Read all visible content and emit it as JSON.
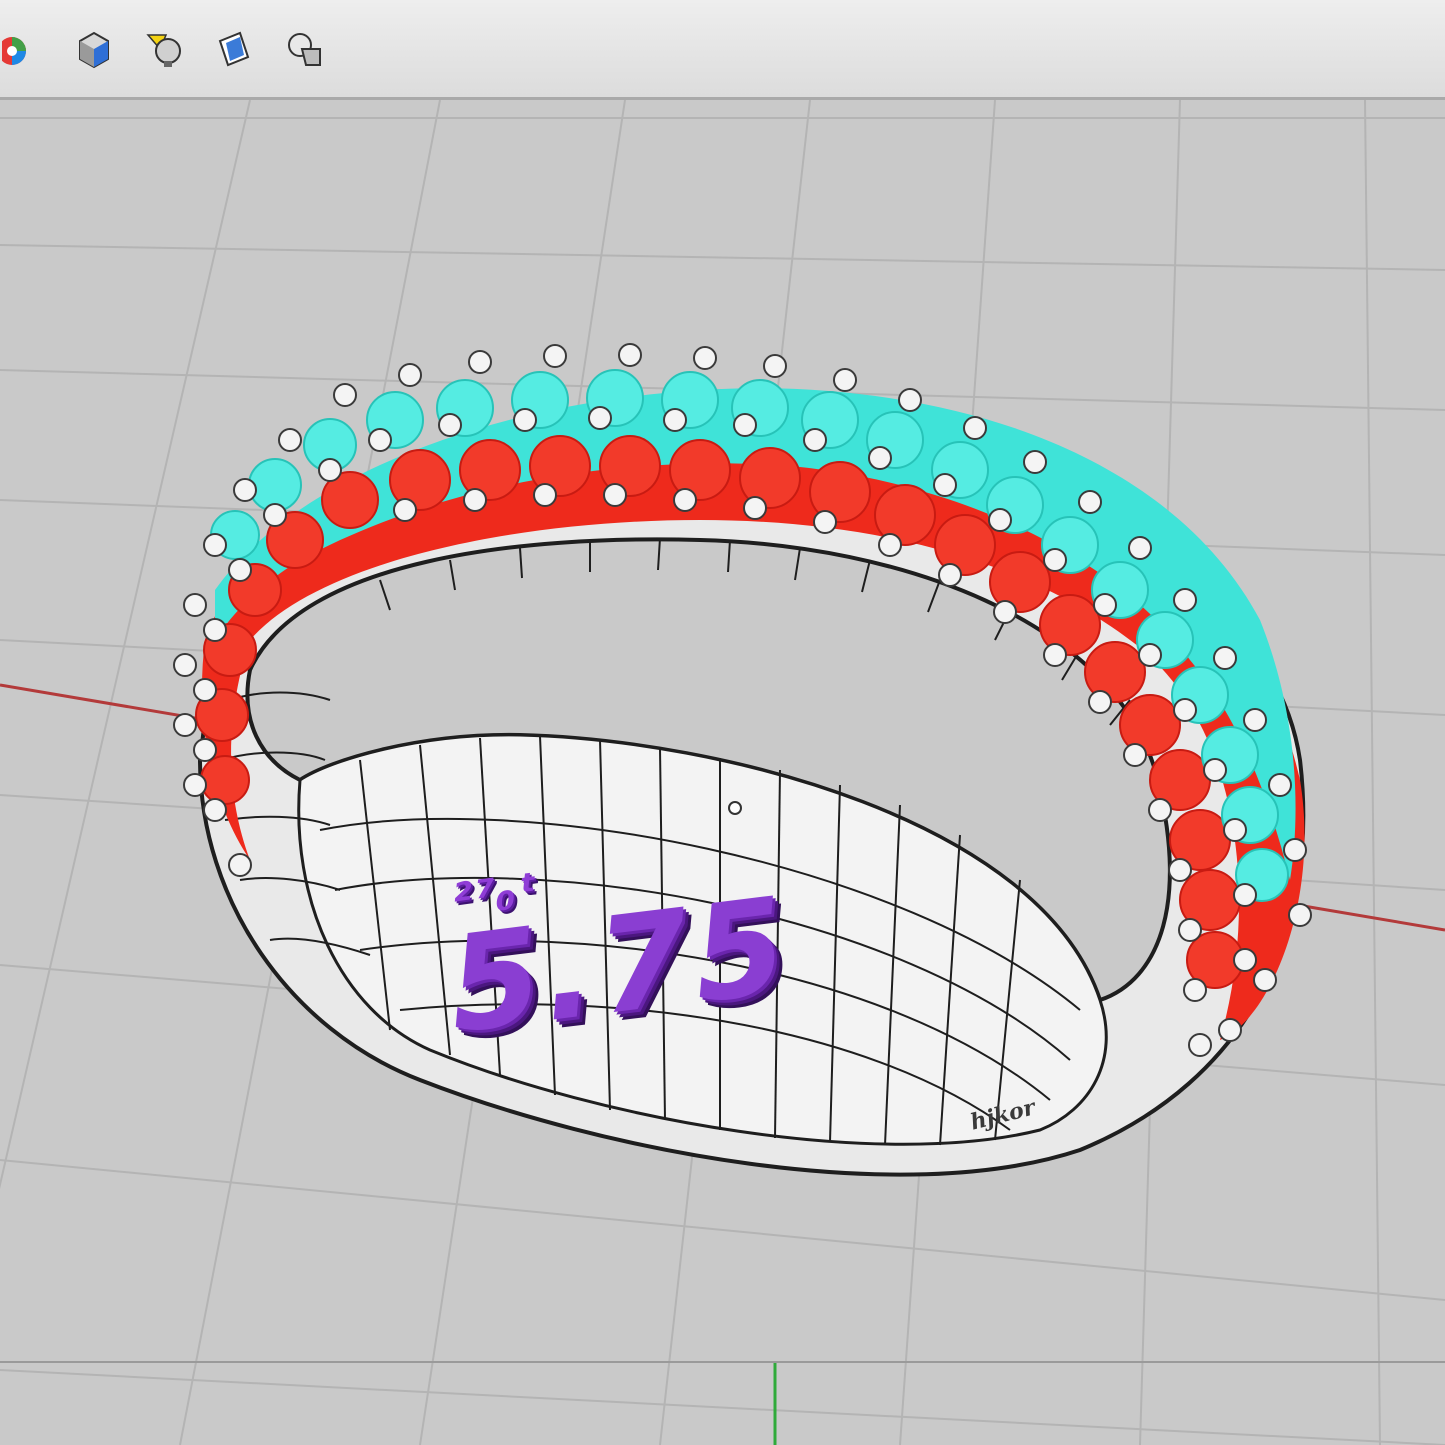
{
  "toolbar": {
    "buttons": [
      {
        "name": "color-wheel-icon"
      },
      {
        "name": "render-shaded-icon"
      },
      {
        "name": "lights-icon"
      },
      {
        "name": "material-icon"
      },
      {
        "name": "shape-icon"
      }
    ]
  },
  "viewport": {
    "size_mark_top": "²⁷₀ᵗ",
    "size_mark_main": "5.75",
    "engraving": "hjkor",
    "colors": {
      "background": "#c9c9c9",
      "grid": "#b4b4b4",
      "x_axis": "#b33a3a",
      "y_axis": "#2faa3a",
      "band": "#efefef",
      "ruby": "#ee2a1c",
      "turquoise": "#3fe3d8",
      "size_mark": "#8a3ed2"
    }
  }
}
